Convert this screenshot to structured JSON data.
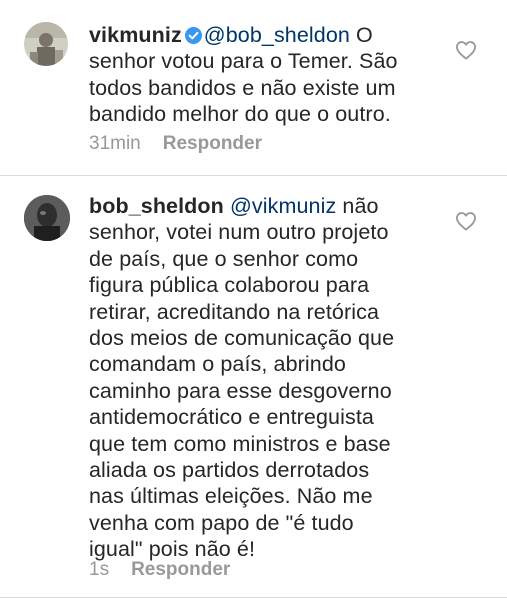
{
  "comments": [
    {
      "username": "vikmuniz",
      "verified": true,
      "mention": "@bob_sheldon",
      "lines": [
        " O",
        "senhor votou para o Temer. São",
        "todos bandidos e não existe um",
        "bandido melhor do que o outro."
      ],
      "time": "31min",
      "reply_label": "Responder",
      "like_icon": "heart-outline-icon"
    },
    {
      "username": "bob_sheldon",
      "verified": false,
      "mention": "@vikmuniz",
      "lines": [
        " não",
        "senhor, votei num outro projeto",
        "de país, que o senhor como",
        "figura pública colaborou para",
        "retirar, acreditando na retórica",
        "dos meios de comunicação que",
        "comandam o país, abrindo",
        "caminho para esse desgoverno",
        "antidemocrático e entreguista",
        "que tem como ministros e base",
        "aliada os partidos derrotados",
        "nas últimas eleições. Não me",
        "venha com papo de \"é tudo",
        "igual\" pois não é!"
      ],
      "time": "1s",
      "reply_label": "Responder",
      "like_icon": "heart-outline-icon"
    }
  ],
  "colors": {
    "text": "#262626",
    "mention": "#003569",
    "meta": "#999999",
    "verified": "#3897f0",
    "divider": "#dbdbdb"
  }
}
